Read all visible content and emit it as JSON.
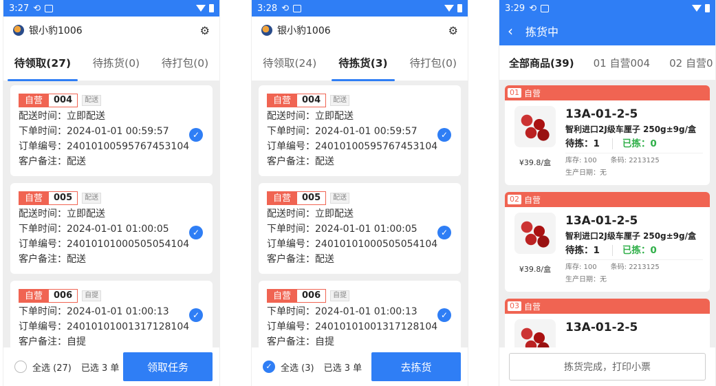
{
  "user": {
    "name": "银小豹1006"
  },
  "screens": {
    "claim": {
      "time": "3:27",
      "tabs": [
        "待领取(27)",
        "待拣货(0)",
        "待打包(0)"
      ],
      "select_all": "全选 (27)",
      "selected": "已选 3 单",
      "action": "领取任务"
    },
    "pick": {
      "time": "3:28",
      "tabs": [
        "待领取(24)",
        "待拣货(3)",
        "待打包(0)"
      ],
      "select_all": "全选 (3)",
      "selected": "已选 3 单",
      "action": "去拣货"
    },
    "picking": {
      "time": "3:29",
      "title": "拣货中",
      "tabs": [
        "全部商品(39)",
        "01 自营004",
        "02 自营0"
      ],
      "finish": "拣货完成，打印小票"
    }
  },
  "orders": [
    {
      "tag": "自营",
      "num": "004",
      "type": "配送",
      "lines": [
        "配送时间：立即配送",
        "下单时间：2024-01-01 00:59:57",
        "订单编号：24010100595767453104",
        "客户备注：配送"
      ]
    },
    {
      "tag": "自营",
      "num": "005",
      "type": "配送",
      "lines": [
        "配送时间：立即配送",
        "下单时间：2024-01-01 01:00:05",
        "订单编号：24010101000505054104",
        "客户备注：配送"
      ]
    },
    {
      "tag": "自营",
      "num": "006",
      "type": "自提",
      "lines": [
        "下单时间：2024-01-01 01:00:13",
        "订单编号：24010101001317128104",
        "客户备注：自提"
      ]
    }
  ],
  "products": [
    {
      "idx": "01",
      "store": "自营",
      "loc": "13A-01-2-5",
      "name": "智利进口2J级车厘子 250g±9g/盒",
      "topick": "待拣：1",
      "picked": "已拣：0",
      "price": "¥39.8/盒",
      "stock": "库存: 100",
      "barcode": "条码: 2213125",
      "date": "生产日期：无"
    },
    {
      "idx": "02",
      "store": "自营",
      "loc": "13A-01-2-5",
      "name": "智利进口2J级车厘子 250g±9g/盒",
      "topick": "待拣：1",
      "picked": "已拣：0",
      "price": "¥39.8/盒",
      "stock": "库存: 100",
      "barcode": "条码: 2213125",
      "date": "生产日期：无"
    },
    {
      "idx": "03",
      "store": "自营",
      "loc": "13A-01-2-5"
    }
  ],
  "colors": {
    "primary": "#2f7ef5",
    "accent": "#f06452",
    "success": "#31b04a"
  }
}
